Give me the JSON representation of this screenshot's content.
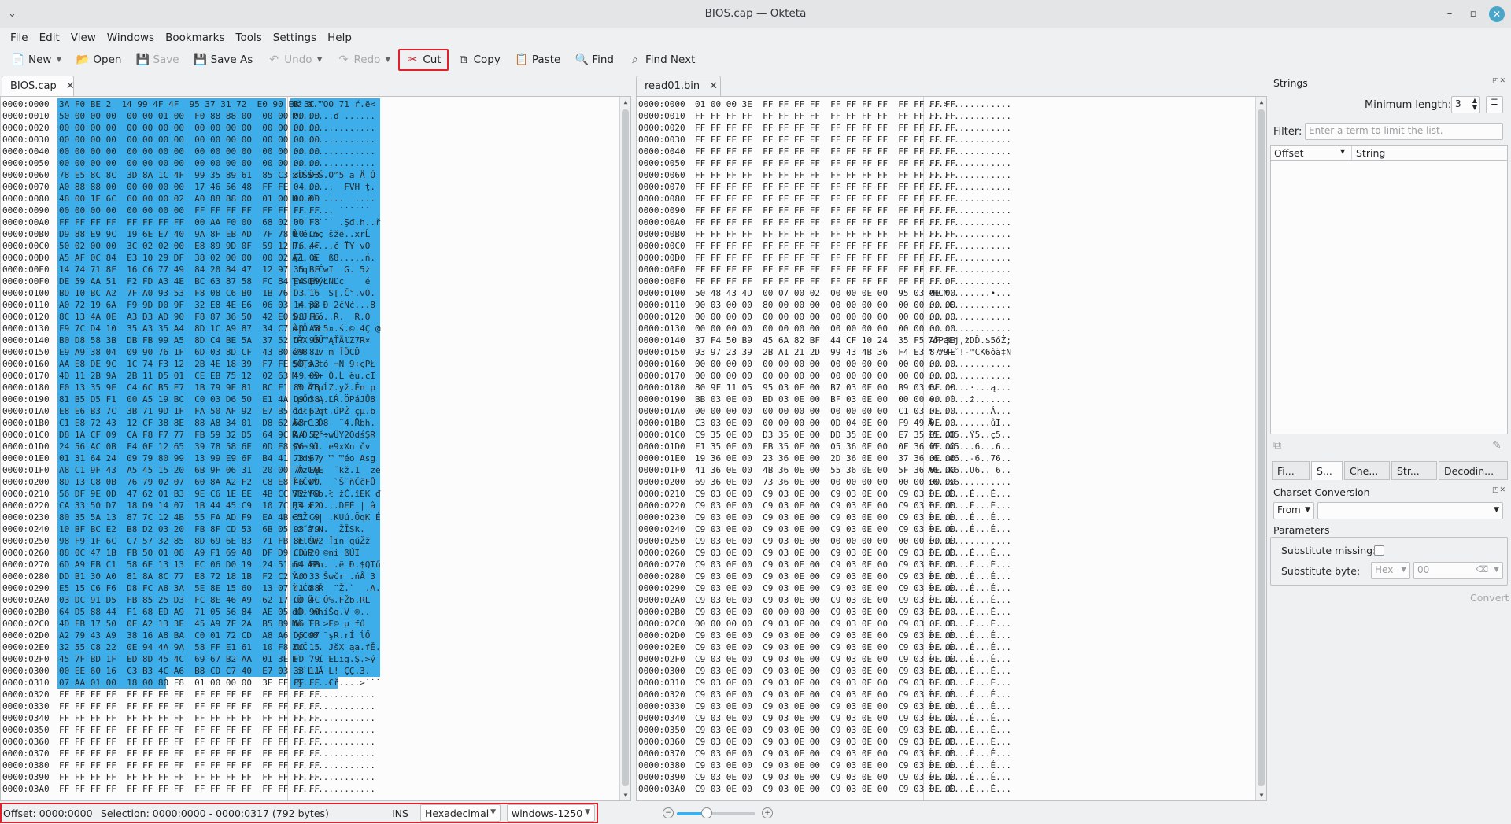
{
  "window": {
    "title": "BIOS.cap — Okteta"
  },
  "menu": [
    "File",
    "Edit",
    "View",
    "Windows",
    "Bookmarks",
    "Tools",
    "Settings",
    "Help"
  ],
  "toolbar": {
    "new": "New",
    "open": "Open",
    "save": "Save",
    "save_as": "Save As",
    "undo": "Undo",
    "redo": "Redo",
    "cut": "Cut",
    "copy": "Copy",
    "paste": "Paste",
    "find": "Find",
    "find_next": "Find Next"
  },
  "tabs": {
    "left": "BIOS.cap",
    "right": "read01.bin"
  },
  "left_view": {
    "offsets": [
      "0000:0000",
      "0000:0010",
      "0000:0020",
      "0000:0030",
      "0000:0040",
      "0000:0050",
      "0000:0060",
      "0000:0070",
      "0000:0080",
      "0000:0090",
      "0000:00A0",
      "0000:00B0",
      "0000:00C0",
      "0000:00D0",
      "0000:00E0",
      "0000:00F0",
      "0000:0100",
      "0000:0110",
      "0000:0120",
      "0000:0130",
      "0000:0140",
      "0000:0150",
      "0000:0160",
      "0000:0170",
      "0000:0180",
      "0000:0190",
      "0000:01A0",
      "0000:01B0",
      "0000:01C0",
      "0000:01D0",
      "0000:01E0",
      "0000:01F0",
      "0000:0200",
      "0000:0210",
      "0000:0220",
      "0000:0230",
      "0000:0240",
      "0000:0250",
      "0000:0260",
      "0000:0270",
      "0000:0280",
      "0000:0290",
      "0000:02A0",
      "0000:02B0",
      "0000:02C0",
      "0000:02D0",
      "0000:02E0",
      "0000:02F0",
      "0000:0300",
      "0000:0310",
      "0000:0320",
      "0000:0330",
      "0000:0340",
      "0000:0350",
      "0000:0360",
      "0000:0370",
      "0000:0380",
      "0000:0390",
      "0000:03A0"
    ],
    "bytes": [
      "3A F0 BE 2  14 99 4F 4F  95 37 31 72  E0 90 EB 3C",
      "50 00 00 00  00 00 01 00  F0 88 88 00  00 00 00 00",
      "00 00 00 00  00 00 00 00  00 00 00 00  00 00 00 00",
      "00 00 00 00  00 00 00 00  00 00 00 00  00 00 00 00",
      "00 00 00 00  00 00 00 00  00 00 00 00  00 00 00 00",
      "00 00 00 00  00 00 00 00  00 00 00 00  00 00 00 00",
      "78 E5 8C 8C  3D 8A 1C 4F  99 35 89 61  85 C3 3D D3",
      "A0 88 88 00  00 00 00 00  17 46 56 48  FF FE 04 00",
      "48 00 1E 6C  60 00 00 02  A0 88 88 00  01 00 00 00",
      "00 00 00 00  00 00 00 00  FF FF FF FF  FF FF FF FF",
      "FF FF FF FF  FF FF FF FF  00 AA F0 00  68 02 00 F8",
      "D9 88 E9 9C  19 6E E7 40  9A 8F EB AD  7F 78 E0 C5",
      "50 02 00 00  3C 02 02 00  E8 89 9D 0F  59 12 76 4F",
      "A5 AF 0C 84  E3 10 29 DF  38 02 00 00  00 02 F1 0E",
      "14 74 71 8F  16 C6 77 49  84 20 84 47  12 97 35 BF",
      "DE 59 AA 51  F2 FD A3 4E  BC 63 87 58  FC 84 E4 E9",
      "BD 10 BC A2  7F A0 93 53  F8 08 C6 B0  1B 76 D3 16",
      "A0 72 19 6A  F9 9D D0 9F  32 E8 4E E6  06 03 14 38",
      "8C 13 4A 0E  A3 D3 AD 90  F8 87 36 50  42 E0 D8 F6",
      "F9 7C D4 10  35 A3 35 A4  8D 1C A9 87  34 C7 40 A8",
      "B0 D8 58 3B  DB FB 99 A5  8D C4 BE 5A  37 52 D7 95",
      "E9 A9 38 04  09 90 76 1F  6D 03 8D CF  43 80 29 81",
      "AA E8 DE 9C  1C 74 F3 12  2B 4E 18 39  F7 FE 50 A3",
      "4D 11 2B 9A  2B 11 D5 01  CE EB 75 12  02 63 49 09",
      "E0 13 35 9E  C4 6C B5 E7  1B 79 9E 81  BC F1 80 78",
      "81 B5 D5 F1  00 A5 19 BC  C0 03 D6 50  E1 4A D9 38",
      "E8 E6 B3 7C  3B 71 9D 1F  FA 50 AF 92  E7 B5 11 62",
      "C1 E8 72 43  12 CF 38 8E  88 A8 34 01  D8 62 68 13",
      "D8 1A CF 09  CA F8 F7 77  FB 59 32 D5  64 9C AA 52",
      "24 56 AC 0B  F4 0F 12 65  39 78 58 6E  0D E8 76 91",
      "01 31 64 24  09 79 80 99  13 99 E9 6F  B4 41 73 67",
      "A8 C1 9F 43  A5 45 15 20  6B 9F 06 31  20 00 7A EB",
      "8D 13 C8 0B  76 79 02 07  60 8A A2 F2  C8 E8 46 D9",
      "56 DF 9E 0D  47 62 01 B3  9E C6 1E EE  4B CC 72 F0",
      "CA 33 50 D7  18 D9 14 07  1B 44 45 C9  10 7C 14 E2",
      "80 35 5A 13  87 7C 12 4B  55 FA AD F9  EA 4B 31 C9",
      "10 BF BC E2  B8 D2 03 20  FB 8F CD 53  6B 05 93 79",
      "98 F9 1F 6C  C7 57 32 85  8D 69 6E 83  71 FB 8E 9F",
      "88 0C 47 1B  FB 50 01 08  A9 F1 69 A8  DF D9 CD 20",
      "6D A9 EB C1  58 6E 13 13  EC 06 D0 19  24 51 54 FB",
      "DD B1 30 A0  81 8A 8C 77  E8 72 18 1B  F2 C2 A0 33",
      "E5 15 C6 F6  D8 FC A8 3A  5E 8E 15 60  13 07 41 88",
      "03 DC 91 D5  FB 85 25 D3  FC 8E 46 A9  62 17 C0 4C",
      "64 D5 88 44  F1 68 ED A9  71 05 56 84  AE 05 1D 90",
      "4D FB 17 50  0E A2 13 3E  45 A9 7F 2A  B5 89 66 FB",
      "A2 79 43 A9  38 16 A8 BA  C0 01 72 CD  A8 A6 D5 97",
      "32 55 C8 22  0E 94 4A 9A  58 FF E1 61  10 F8 CC 15",
      "45 7F BD 1F  ED 8D 45 4C  69 67 B2 AA  01 3E FD 79",
      "00 EE 60 16  C3 B3 4C A6  B8 CD C7 40  E7 03 33 11",
      "07 AA 01 00  18 00 80 F8  01 00 00 00  3E FF FF FF",
      "FF FF FF FF  FF FF FF FF  FF FF FF FF  FF FF FF FF",
      "FF FF FF FF  FF FF FF FF  FF FF FF FF  FF FF FF FF",
      "FF FF FF FF  FF FF FF FF  FF FF FF FF  FF FF FF FF",
      "FF FF FF FF  FF FF FF FF  FF FF FF FF  FF FF FF FF",
      "FF FF FF FF  FF FF FF FF  FF FF FF FF  FF FF FF FF",
      "FF FF FF FF  FF FF FF FF  FF FF FF FF  FF FF FF FF",
      "FF FF FF FF  FF FF FF FF  FF FF FF FF  FF FF FF FF",
      "FF FF FF FF  FF FF FF FF  FF FF FF FF  FF FF FF FF",
      "FF FF FF FF  FF FF FF FF  FF FF FF FF  FF FF FF FF"
    ],
    "chars": [
      "Ož.ä.™OO 71 ŕ.ë<",
      "P.......đ ......",
      "................",
      "................",
      "................",
      "................",
      "xĺŚŚ=Š.O™5 a Ä Ó",
      "  ......  FVH ţ.",
      "H..ë` ....  ....",
      "........ ˙˙˙˙˙˙",
      "˙˙˙˙˙˙˙˙ .Şđ.h..ř",
      "Ů é.nç šžë..xrĹ",
      "P...<...č ŤY vO",
      "ĄŽ. ä  ß8.....ń.",
      ".tq .ĆwI  G. 5ż",
      "ŢYSQňýŁNĽc    é",
      "˝ .˘ˇ  S[.Č°.vÓ.",
      " r.jů Đ 2čNć...8",
      "Š.J.Łó..Ř.  Ř.Ö",
      "ů|Ô 5Ł5¤.ś.© 4Ç @",
      "°ŘX ŰŰ™ĄŤÄľZ7R×",
      "é©8 .v m ŤĎCĎ  ",
      "ŞČŢś.tó ¬N 9÷çPŁ",
      "M .+š+ Ő.Ĺ ëu.cI",
      " 5 ÄlµĺZ.yž.Ěn p",
      " µŐń Ą.ĽŔ.ÖPáJŮ8",
      "čćł| qt.úPŻ çµ.b",
      "ÁčrC Ď8  ¨4.Řbh.",
      "Ř.Ď.Ęř÷wŰY2ŐdśŞR",
      "$V¬.ô. e9xXn čv ",
      ".1d$ y ™ ™éo Asg",
      "¨ÁzCĄE  ˘kž.1  zë",
      "Ť.ČvÝ.  `Š˘ňČčFŮ",
      "VßžYGb.ł žĆ.îEK đ",
      "Ę3 ×.Ö...DEÉ | â",
      "€5Ž «| .KUú.ÖqK É",
      ".ż˝â.N.  ŽĪSk. ",
      ".řlĆW2 Ťin qűŽž",
      "..ŭP  ©ni ßÚI ",
      "m© ÁPn. .ë Đ.$QTű",
      "Ý.0 . Šwčr .ńÂ 3",
      "ĺ.Ćö Ř  ¨Ž.`  .A.",
      ".Ü Ő  Ó%.FŽb.RL",
      "dŐ. ńhíŠq.V ®..",
      "Mű ˘. >E© µ fű",
      "˘yC©8 ¨şR.rÍ ĺŐ",
      "2UČ  . JšX ąa.fĚ.",
      "E˘ ˝ í ELig.Ş.>ý",
      ".î`L.Ă L! ÇÇ.3.",
      ".Ş.....€ř....>˙˙˙",
      "................",
      "................",
      "................",
      "................",
      "................",
      "................",
      "................",
      "................",
      "................"
    ]
  },
  "right_view": {
    "offsets": [
      "0000:0000",
      "0000:0010",
      "0000:0020",
      "0000:0030",
      "0000:0040",
      "0000:0050",
      "0000:0060",
      "0000:0070",
      "0000:0080",
      "0000:0090",
      "0000:00A0",
      "0000:00B0",
      "0000:00C0",
      "0000:00D0",
      "0000:00E0",
      "0000:00F0",
      "0000:0100",
      "0000:0110",
      "0000:0120",
      "0000:0130",
      "0000:0140",
      "0000:0150",
      "0000:0160",
      "0000:0170",
      "0000:0180",
      "0000:0190",
      "0000:01A0",
      "0000:01B0",
      "0000:01C0",
      "0000:01D0",
      "0000:01E0",
      "0000:01F0",
      "0000:0200",
      "0000:0210",
      "0000:0220",
      "0000:0230",
      "0000:0240",
      "0000:0250",
      "0000:0260",
      "0000:0270",
      "0000:0280",
      "0000:0290",
      "0000:02A0",
      "0000:02B0",
      "0000:02C0",
      "0000:02D0",
      "0000:02E0",
      "0000:02F0",
      "0000:0300",
      "0000:0310",
      "0000:0320",
      "0000:0330",
      "0000:0340",
      "0000:0350",
      "0000:0360",
      "0000:0370",
      "0000:0380",
      "0000:0390",
      "0000:03A0"
    ],
    "bytes": [
      "01 00 00 3E  FF FF FF FF  FF FF FF FF  FF FF FF FF",
      "FF FF FF FF  FF FF FF FF  FF FF FF FF  FF FF FF FF",
      "FF FF FF FF  FF FF FF FF  FF FF FF FF  FF FF FF FF",
      "FF FF FF FF  FF FF FF FF  FF FF FF FF  FF FF FF FF",
      "FF FF FF FF  FF FF FF FF  FF FF FF FF  FF FF FF FF",
      "FF FF FF FF  FF FF FF FF  FF FF FF FF  FF FF FF FF",
      "FF FF FF FF  FF FF FF FF  FF FF FF FF  FF FF FF FF",
      "FF FF FF FF  FF FF FF FF  FF FF FF FF  FF FF FF FF",
      "FF FF FF FF  FF FF FF FF  FF FF FF FF  FF FF FF FF",
      "FF FF FF FF  FF FF FF FF  FF FF FF FF  FF FF FF FF",
      "FF FF FF FF  FF FF FF FF  FF FF FF FF  FF FF FF FF",
      "FF FF FF FF  FF FF FF FF  FF FF FF FF  FF FF FF FF",
      "FF FF FF FF  FF FF FF FF  FF FF FF FF  FF FF FF FF",
      "FF FF FF FF  FF FF FF FF  FF FF FF FF  FF FF FF FF",
      "FF FF FF FF  FF FF FF FF  FF FF FF FF  FF FF FF FF",
      "FF FF FF FF  FF FF FF FF  FF FF FF FF  FF FF FF 0F",
      "50 48 43 4D  00 07 00 02  00 00 0E 00  95 03 0E 00",
      "90 03 00 00  80 00 00 00  00 00 00 00  00 00 00 00",
      "00 00 00 00  00 00 00 00  00 00 00 00  00 00 00 00",
      "00 00 00 00  00 00 00 00  00 00 00 00  00 00 00 00",
      "37 F4 50 B9  45 6A 82 BF  44 CF 10 24  35 F5 AF 3B",
      "93 97 23 39  2B A1 21 2D  99 43 4B 36  F4 E3 87 4E",
      "00 00 00 00  00 00 00 00  00 00 00 00  00 00 00 00",
      "00 00 00 00  00 00 00 00  00 00 00 00  00 00 00 00",
      "80 9F 11 05  95 03 0E 00  B7 03 0E 00  B9 03 0E 00",
      "BB 03 0E 00  BD 03 0E 00  BF 03 0E 00  00 00 00 00",
      "00 00 00 00  00 00 00 00  00 00 00 00  C1 03 0E 00",
      "C3 03 0E 00  00 00 00 00  0D 04 0E 00  F9 49 0E 00",
      "C9 35 0E 00  D3 35 0E 00  DD 35 0E 00  E7 35 0E 00",
      "F1 35 0E 00  FB 35 0E 00  05 36 0E 00  0F 36 0E 00",
      "19 36 0E 00  23 36 0E 00  2D 36 0E 00  37 36 0E 00",
      "41 36 0E 00  4B 36 0E 00  55 36 0E 00  5F 36 0E 00",
      "69 36 0E 00  73 36 0E 00  00 00 00 00  00 00 00 00",
      "C9 03 0E 00  C9 03 0E 00  C9 03 0E 00  C9 03 0E 00",
      "C9 03 0E 00  C9 03 0E 00  C9 03 0E 00  C9 03 0E 00",
      "C9 03 0E 00  C9 03 0E 00  C9 03 0E 00  C9 03 0E 00",
      "C9 03 0E 00  C9 03 0E 00  C9 03 0E 00  C9 03 0E 00",
      "C9 03 0E 00  C9 03 0E 00  00 00 00 00  00 00 00 00",
      "C9 03 0E 00  C9 03 0E 00  C9 03 0E 00  C9 03 0E 00",
      "C9 03 0E 00  C9 03 0E 00  C9 03 0E 00  C9 03 0E 00",
      "C9 03 0E 00  C9 03 0E 00  C9 03 0E 00  C9 03 0E 00",
      "C9 03 0E 00  C9 03 0E 00  C9 03 0E 00  C9 03 0E 00",
      "C9 03 0E 00  C9 03 0E 00  C9 03 0E 00  C9 03 0E 00",
      "C9 03 0E 00  00 00 00 00  C9 03 0E 00  C9 03 0E 00",
      "00 00 00 00  C9 03 0E 00  C9 03 0E 00  C9 03 0E 00",
      "C9 03 0E 00  C9 03 0E 00  C9 03 0E 00  C9 03 0E 00",
      "C9 03 0E 00  C9 03 0E 00  C9 03 0E 00  C9 03 0E 00",
      "C9 03 0E 00  C9 03 0E 00  C9 03 0E 00  C9 03 0E 00",
      "C9 03 0E 00  C9 03 0E 00  C9 03 0E 00  C9 03 0E 00",
      "C9 03 0E 00  C9 03 0E 00  C9 03 0E 00  C9 03 0E 00",
      "C9 03 0E 00  C9 03 0E 00  C9 03 0E 00  C9 03 0E 00",
      "C9 03 0E 00  C9 03 0E 00  C9 03 0E 00  C9 03 0E 00",
      "C9 03 0E 00  C9 03 0E 00  C9 03 0E 00  C9 03 0E 00",
      "C9 03 0E 00  C9 03 0E 00  C9 03 0E 00  C9 03 0E 00",
      "C9 03 0E 00  C9 03 0E 00  C9 03 0E 00  C9 03 0E 00",
      "C9 03 0E 00  C9 03 0E 00  C9 03 0E 00  C9 03 0E 00",
      "C9 03 0E 00  C9 03 0E 00  C9 03 0E 00  C9 03 0E 00",
      "C9 03 0E 00  C9 03 0E 00  C9 03 0E 00  C9 03 0E 00",
      "C9 03 0E 00  C9 03 0E 00  C9 03 0E 00  C9 03 0E 00"
    ],
    "chars": [
      "...>............",
      "................",
      "................",
      "................",
      "................",
      "................",
      "................",
      "................",
      "................",
      "................",
      "................",
      "................",
      "................",
      "................",
      "................",
      "................",
      "PHCM........•...",
      "....€...........",
      "................",
      "................",
      "7ôPąEj‚żDĎ.$5őŻ;",
      "“—#9+ˇ!-™CK6ôă‡N",
      "................",
      "................",
      "€ź..•...·...ą...",
      "»...˝...ż.......",
      "............Á...",
      "Ă...........ůI..",
      "É5..Ó5..Ý5..ç5..",
      "ń5..ű5...6...6..",
      ".6..#6..-6..76..",
      "A6..K6..U6.._6..",
      "i6..s6..........",
      "É...É...É...É...",
      "É...É...É...É...",
      "É...É...É...É...",
      "É...É...É...É...",
      "É...É...........",
      "É...É...É...É...",
      "É...É...É...É...",
      "É...É...É...É...",
      "É...É...É...É...",
      "É...É...É...É...",
      "É.......É...É...",
      "....É...É...É...",
      "É...É...É...É...",
      "É...É...É...É...",
      "É...É...É...É...",
      "É...É...É...É...",
      "É...É...É...É...",
      "É...É...É...É...",
      "É...É...É...É...",
      "É...É...É...É...",
      "É...É...É...É...",
      "É...É...É...É...",
      "É...É...É...É...",
      "É...É...É...É...",
      "É...É...É...É...",
      "É...É...É...É..."
    ]
  },
  "strings_panel": {
    "title": "Strings",
    "min_length_label": "Minimum length:",
    "min_length_value": "3",
    "filter_label": "Filter:",
    "filter_placeholder": "Enter a term to limit the list.",
    "col_offset": "Offset",
    "col_string": "String",
    "tabs": [
      "Fi...",
      "S...",
      "Che...",
      "Str...",
      "Decodin..."
    ]
  },
  "charset_panel": {
    "title": "Charset Conversion",
    "direction": "From",
    "parameters_label": "Parameters",
    "substitute_missing_label": "Substitute missing:",
    "substitute_byte_label": "Substitute byte:",
    "byte_format": "Hex",
    "byte_value": "00",
    "convert_label": "Convert"
  },
  "status": {
    "offset": "Offset: 0000:0000",
    "selection": "Selection: 0000:0000 - 0000:0317 (792 bytes)",
    "mode": "INS",
    "value_coding": "Hexadecimal",
    "charset": "windows-1250",
    "zoom_level": 0.38
  },
  "colors": {
    "selection": "#3daee9",
    "highlight_box": "#e0202a"
  }
}
